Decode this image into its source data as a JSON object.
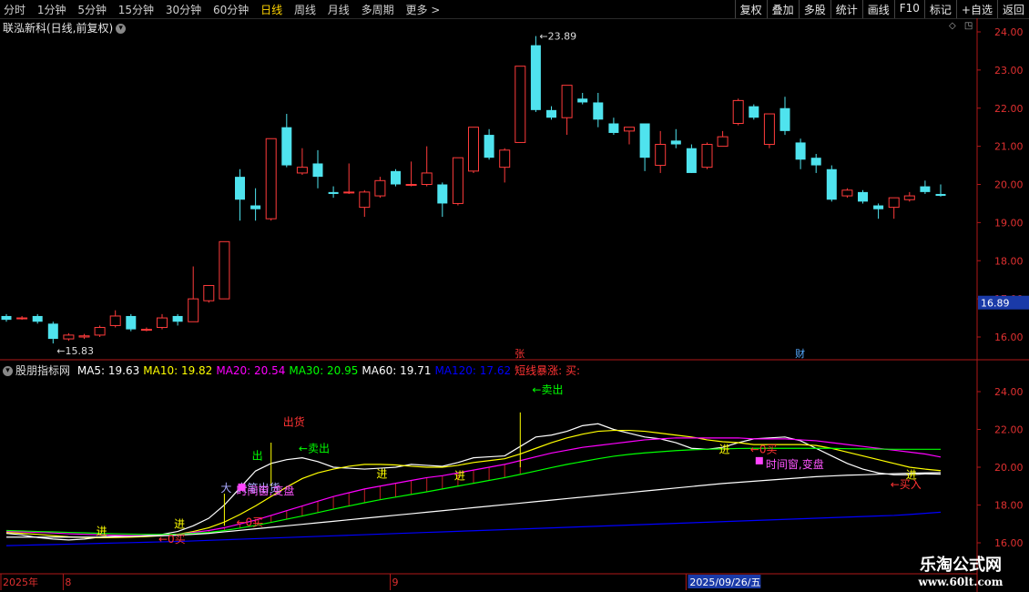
{
  "toolbar": {
    "periods": [
      "分时",
      "1分钟",
      "5分钟",
      "15分钟",
      "30分钟",
      "60分钟",
      "日线",
      "周线",
      "月线",
      "多周期",
      "更多 >"
    ],
    "active_period": "日线",
    "tools": [
      "复权",
      "叠加",
      "多股",
      "统计",
      "画线",
      "F10",
      "标记",
      "+自选",
      "返回"
    ]
  },
  "stock": {
    "title": "联泓新科(日线,前复权)"
  },
  "indicator": {
    "name": "股朋指标网",
    "ma_labels": [
      {
        "text": "MA5: 19.63",
        "color": "#ffffff"
      },
      {
        "text": "MA10: 19.82",
        "color": "#ffff00"
      },
      {
        "text": "MA20: 20.54",
        "color": "#ff00ff"
      },
      {
        "text": "MA30: 20.95",
        "color": "#00ff00"
      },
      {
        "text": "MA60: 19.71",
        "color": "#ffffff"
      },
      {
        "text": "MA120: 17.62",
        "color": "#0000ff"
      },
      {
        "text": "短线暴涨: 买:",
        "color": "#ff3333"
      }
    ]
  },
  "chart_data": [
    {
      "type": "candlestick",
      "title": "联泓新科(日线,前复权)",
      "ylim": [
        15.6,
        24.3
      ],
      "yticks": [
        "24.00",
        "23.00",
        "22.00",
        "21.00",
        "20.00",
        "19.00",
        "18.00",
        "17.00",
        "16.00"
      ],
      "current_price": "16.89",
      "high_label": "23.89",
      "low_label": "15.83",
      "markers": [
        {
          "label": "张",
          "index": 33,
          "color": "#ff3333"
        },
        {
          "label": "财",
          "index": 51,
          "color": "#55aaff"
        }
      ],
      "candles": [
        {
          "o": 16.55,
          "h": 16.6,
          "c": 16.45,
          "l": 16.4
        },
        {
          "o": 16.5,
          "h": 16.55,
          "c": 16.5,
          "l": 16.45
        },
        {
          "o": 16.55,
          "h": 16.6,
          "c": 16.4,
          "l": 16.35
        },
        {
          "o": 16.35,
          "h": 16.4,
          "c": 15.95,
          "l": 15.83
        },
        {
          "o": 15.95,
          "h": 16.1,
          "c": 16.05,
          "l": 15.9
        },
        {
          "o": 16.0,
          "h": 16.08,
          "c": 16.03,
          "l": 15.95
        },
        {
          "o": 16.05,
          "h": 16.3,
          "c": 16.25,
          "l": 16.0
        },
        {
          "o": 16.3,
          "h": 16.7,
          "c": 16.55,
          "l": 16.25
        },
        {
          "o": 16.55,
          "h": 16.6,
          "c": 16.2,
          "l": 16.15
        },
        {
          "o": 16.2,
          "h": 16.25,
          "c": 16.2,
          "l": 16.15
        },
        {
          "o": 16.25,
          "h": 16.6,
          "c": 16.5,
          "l": 16.2
        },
        {
          "o": 16.55,
          "h": 16.6,
          "c": 16.4,
          "l": 16.3
        },
        {
          "o": 16.4,
          "h": 17.85,
          "c": 17.0,
          "l": 16.4
        },
        {
          "o": 16.95,
          "h": 17.25,
          "c": 17.35,
          "l": 16.9
        },
        {
          "o": 17.0,
          "h": 18.5,
          "c": 18.5,
          "l": 17.0
        },
        {
          "o": 20.2,
          "h": 20.4,
          "c": 19.6,
          "l": 19.05
        },
        {
          "o": 19.45,
          "h": 19.9,
          "c": 19.35,
          "l": 19.05
        },
        {
          "o": 19.1,
          "h": 21.2,
          "c": 21.2,
          "l": 19.05
        },
        {
          "o": 21.5,
          "h": 21.85,
          "c": 20.5,
          "l": 20.45
        },
        {
          "o": 20.3,
          "h": 20.95,
          "c": 20.45,
          "l": 20.25
        },
        {
          "o": 20.55,
          "h": 20.9,
          "c": 20.2,
          "l": 19.9
        },
        {
          "o": 19.8,
          "h": 19.95,
          "c": 19.75,
          "l": 19.65
        },
        {
          "o": 19.8,
          "h": 20.55,
          "c": 19.8,
          "l": 19.75
        },
        {
          "o": 19.4,
          "h": 19.85,
          "c": 19.8,
          "l": 19.15
        },
        {
          "o": 19.7,
          "h": 20.2,
          "c": 20.1,
          "l": 19.65
        },
        {
          "o": 20.35,
          "h": 20.4,
          "c": 20.0,
          "l": 19.95
        },
        {
          "o": 20.0,
          "h": 20.6,
          "c": 20.0,
          "l": 19.95
        },
        {
          "o": 20.0,
          "h": 21.0,
          "c": 20.3,
          "l": 19.95
        },
        {
          "o": 20.0,
          "h": 20.05,
          "c": 19.5,
          "l": 19.15
        },
        {
          "o": 19.5,
          "h": 20.7,
          "c": 20.7,
          "l": 19.45
        },
        {
          "o": 20.35,
          "h": 21.5,
          "c": 21.5,
          "l": 20.3
        },
        {
          "o": 21.3,
          "h": 21.45,
          "c": 20.7,
          "l": 20.65
        },
        {
          "o": 20.45,
          "h": 20.95,
          "c": 20.9,
          "l": 20.05
        },
        {
          "o": 21.1,
          "h": 23.1,
          "c": 23.1,
          "l": 21.1
        },
        {
          "o": 23.65,
          "h": 23.89,
          "c": 21.95,
          "l": 21.9
        },
        {
          "o": 21.95,
          "h": 22.05,
          "c": 21.75,
          "l": 21.7
        },
        {
          "o": 21.75,
          "h": 22.6,
          "c": 22.6,
          "l": 21.3
        },
        {
          "o": 22.25,
          "h": 22.4,
          "c": 22.15,
          "l": 22.1
        },
        {
          "o": 22.15,
          "h": 22.4,
          "c": 21.7,
          "l": 21.5
        },
        {
          "o": 21.6,
          "h": 21.75,
          "c": 21.35,
          "l": 21.3
        },
        {
          "o": 21.4,
          "h": 21.5,
          "c": 21.5,
          "l": 21.05
        },
        {
          "o": 21.6,
          "h": 21.6,
          "c": 20.7,
          "l": 20.35
        },
        {
          "o": 20.5,
          "h": 21.4,
          "c": 21.05,
          "l": 20.3
        },
        {
          "o": 21.15,
          "h": 21.45,
          "c": 21.05,
          "l": 20.95
        },
        {
          "o": 20.95,
          "h": 21.05,
          "c": 20.3,
          "l": 20.3
        },
        {
          "o": 20.45,
          "h": 21.1,
          "c": 21.05,
          "l": 20.4
        },
        {
          "o": 21.0,
          "h": 21.4,
          "c": 21.25,
          "l": 21.0
        },
        {
          "o": 21.6,
          "h": 22.25,
          "c": 22.2,
          "l": 21.55
        },
        {
          "o": 22.05,
          "h": 22.1,
          "c": 21.75,
          "l": 21.7
        },
        {
          "o": 21.05,
          "h": 21.85,
          "c": 21.85,
          "l": 20.95
        },
        {
          "o": 22.0,
          "h": 22.3,
          "c": 21.4,
          "l": 21.3
        },
        {
          "o": 21.1,
          "h": 21.2,
          "c": 20.65,
          "l": 20.4
        },
        {
          "o": 20.7,
          "h": 20.8,
          "c": 20.5,
          "l": 20.3
        },
        {
          "o": 20.4,
          "h": 20.5,
          "c": 19.6,
          "l": 19.55
        },
        {
          "o": 19.7,
          "h": 19.9,
          "c": 19.85,
          "l": 19.65
        },
        {
          "o": 19.8,
          "h": 19.85,
          "c": 19.55,
          "l": 19.5
        },
        {
          "o": 19.45,
          "h": 19.5,
          "c": 19.35,
          "l": 19.1
        },
        {
          "o": 19.4,
          "h": 19.65,
          "c": 19.65,
          "l": 19.1
        },
        {
          "o": 19.6,
          "h": 19.8,
          "c": 19.7,
          "l": 19.55
        },
        {
          "o": 19.95,
          "h": 20.1,
          "c": 19.8,
          "l": 19.75
        },
        {
          "o": 19.75,
          "h": 20.0,
          "c": 19.7,
          "l": 19.68
        }
      ]
    },
    {
      "type": "line",
      "title": "股朋指标网",
      "ylim": [
        15.8,
        25.4
      ],
      "yticks": [
        "24.00",
        "22.00",
        "20.00",
        "18.00",
        "16.00"
      ],
      "series": [
        {
          "name": "MA5",
          "color": "#ffffff",
          "values": [
            16.5,
            16.42,
            16.28,
            16.2,
            16.15,
            16.2,
            16.3,
            16.35,
            16.35,
            16.4,
            16.45,
            16.6,
            16.9,
            17.3,
            18.0,
            18.9,
            19.8,
            20.2,
            20.4,
            20.5,
            20.3,
            20.0,
            19.95,
            19.9,
            19.95,
            20.0,
            20.15,
            20.1,
            20.05,
            20.25,
            20.5,
            20.55,
            20.6,
            21.1,
            21.6,
            21.7,
            21.9,
            22.2,
            22.3,
            22.0,
            21.8,
            21.6,
            21.5,
            21.3,
            21.0,
            20.95,
            21.05,
            21.3,
            21.5,
            21.55,
            21.6,
            21.4,
            21.0,
            20.6,
            20.2,
            19.9,
            19.7,
            19.6,
            19.6,
            19.65,
            19.63
          ]
        },
        {
          "name": "MA10",
          "color": "#ffff00",
          "values": [
            16.55,
            16.5,
            16.45,
            16.38,
            16.32,
            16.28,
            16.27,
            16.28,
            16.3,
            16.33,
            16.38,
            16.45,
            16.6,
            16.8,
            17.1,
            17.5,
            17.95,
            18.45,
            18.95,
            19.4,
            19.7,
            19.9,
            20.05,
            20.15,
            20.15,
            20.12,
            20.05,
            20.0,
            20.0,
            20.1,
            20.25,
            20.35,
            20.45,
            20.7,
            21.0,
            21.3,
            21.55,
            21.75,
            21.9,
            21.95,
            21.95,
            21.9,
            21.8,
            21.7,
            21.6,
            21.45,
            21.35,
            21.3,
            21.2,
            21.2,
            21.2,
            21.2,
            21.15,
            21.0,
            20.8,
            20.6,
            20.4,
            20.2,
            20.0,
            19.9,
            19.82
          ]
        },
        {
          "name": "MA20",
          "color": "#ff00ff",
          "values": [
            16.6,
            16.58,
            16.55,
            16.52,
            16.48,
            16.45,
            16.42,
            16.4,
            16.38,
            16.38,
            16.4,
            16.45,
            16.55,
            16.65,
            16.8,
            17.0,
            17.2,
            17.45,
            17.7,
            17.95,
            18.2,
            18.45,
            18.65,
            18.85,
            19.0,
            19.15,
            19.3,
            19.45,
            19.55,
            19.7,
            19.85,
            20.0,
            20.15,
            20.35,
            20.55,
            20.75,
            20.9,
            21.05,
            21.15,
            21.25,
            21.35,
            21.45,
            21.5,
            21.55,
            21.55,
            21.55,
            21.55,
            21.55,
            21.5,
            21.5,
            21.5,
            21.45,
            21.4,
            21.3,
            21.2,
            21.1,
            21.0,
            20.9,
            20.8,
            20.7,
            20.54
          ]
        },
        {
          "name": "MA30",
          "color": "#00ff00",
          "values": [
            16.65,
            16.63,
            16.6,
            16.58,
            16.55,
            16.53,
            16.5,
            16.48,
            16.46,
            16.45,
            16.45,
            16.46,
            16.5,
            16.55,
            16.65,
            16.78,
            16.92,
            17.08,
            17.25,
            17.42,
            17.6,
            17.78,
            17.95,
            18.12,
            18.28,
            18.42,
            18.56,
            18.7,
            18.85,
            19.0,
            19.15,
            19.3,
            19.45,
            19.62,
            19.8,
            19.98,
            20.15,
            20.3,
            20.45,
            20.58,
            20.68,
            20.76,
            20.82,
            20.88,
            20.92,
            20.95,
            20.97,
            20.99,
            21.0,
            21.0,
            21.0,
            21.0,
            21.0,
            21.0,
            20.98,
            20.97,
            20.96,
            20.95,
            20.95,
            20.95,
            20.95
          ]
        },
        {
          "name": "MA60",
          "color": "#ffffff",
          "values": [
            16.3,
            16.3,
            16.3,
            16.3,
            16.3,
            16.3,
            16.3,
            16.32,
            16.34,
            16.36,
            16.38,
            16.4,
            16.45,
            16.5,
            16.58,
            16.66,
            16.74,
            16.82,
            16.9,
            16.98,
            17.06,
            17.14,
            17.22,
            17.3,
            17.38,
            17.46,
            17.54,
            17.62,
            17.7,
            17.78,
            17.86,
            17.94,
            18.02,
            18.1,
            18.18,
            18.26,
            18.34,
            18.42,
            18.5,
            18.58,
            18.66,
            18.74,
            18.82,
            18.9,
            18.98,
            19.06,
            19.14,
            19.2,
            19.26,
            19.32,
            19.38,
            19.44,
            19.5,
            19.54,
            19.58,
            19.6,
            19.63,
            19.66,
            19.68,
            19.7,
            19.71
          ]
        },
        {
          "name": "MA120",
          "color": "#0000ff",
          "values": [
            15.85,
            15.87,
            15.89,
            15.91,
            15.93,
            15.95,
            15.97,
            15.99,
            16.01,
            16.03,
            16.05,
            16.07,
            16.1,
            16.13,
            16.16,
            16.19,
            16.22,
            16.25,
            16.28,
            16.31,
            16.34,
            16.37,
            16.4,
            16.43,
            16.46,
            16.49,
            16.52,
            16.55,
            16.58,
            16.61,
            16.64,
            16.67,
            16.7,
            16.73,
            16.76,
            16.79,
            16.82,
            16.85,
            16.88,
            16.91,
            16.94,
            16.97,
            17.0,
            17.03,
            17.06,
            17.09,
            17.12,
            17.15,
            17.18,
            17.21,
            17.24,
            17.27,
            17.3,
            17.33,
            17.36,
            17.39,
            17.42,
            17.45,
            17.5,
            17.56,
            17.62
          ]
        }
      ],
      "signals": [
        {
          "label": "进",
          "index": 6,
          "value": 16.4,
          "color": "#ffff00"
        },
        {
          "label": "←0买",
          "index": 10,
          "value": 16.0,
          "color": "#ff3333"
        },
        {
          "label": "进",
          "index": 11,
          "value": 16.8,
          "color": "#ffff00"
        },
        {
          "label": "←0买",
          "index": 15,
          "value": 16.9,
          "color": "#ff3333"
        },
        {
          "label": "大",
          "index": 14,
          "value": 18.7,
          "color": "#aaaaff"
        },
        {
          "label": "大笔出货",
          "index": 15,
          "value": 18.7,
          "color": "#aaaaff"
        },
        {
          "label": "时间窗,变盘",
          "index": 15,
          "value": 18.55,
          "color": "#ff55ff"
        },
        {
          "label": "出",
          "index": 16,
          "value": 20.4,
          "color": "#00ff00"
        },
        {
          "label": "出货",
          "index": 18,
          "value": 22.2,
          "color": "#ff3333"
        },
        {
          "label": "←卖出",
          "index": 19,
          "value": 20.8,
          "color": "#00ff00"
        },
        {
          "label": "进",
          "index": 24,
          "value": 19.45,
          "color": "#ffff00"
        },
        {
          "label": "进",
          "index": 29,
          "value": 19.35,
          "color": "#ffff00"
        },
        {
          "label": "←卖出",
          "index": 34,
          "value": 23.9,
          "color": "#00ff00"
        },
        {
          "label": "进",
          "index": 46,
          "value": 20.75,
          "color": "#ffff00"
        },
        {
          "label": "←0买",
          "index": 48,
          "value": 20.75,
          "color": "#ff3333"
        },
        {
          "label": "时间窗,变盘",
          "index": 49,
          "value": 19.95,
          "color": "#ff55ff"
        },
        {
          "label": "进",
          "index": 58,
          "value": 19.4,
          "color": "#ffff00"
        },
        {
          "label": "←买入",
          "index": 57,
          "value": 18.9,
          "color": "#ff3333"
        }
      ]
    }
  ],
  "x_axis": {
    "labels": [
      {
        "text": "2025年",
        "index": 0
      },
      {
        "text": "8",
        "index": 4
      },
      {
        "text": "9",
        "index": 25
      },
      {
        "text": "2025/09/26/五",
        "index": 44
      }
    ]
  },
  "watermark": {
    "line1": "乐淘公式网",
    "line2": "www.60lt.com"
  }
}
